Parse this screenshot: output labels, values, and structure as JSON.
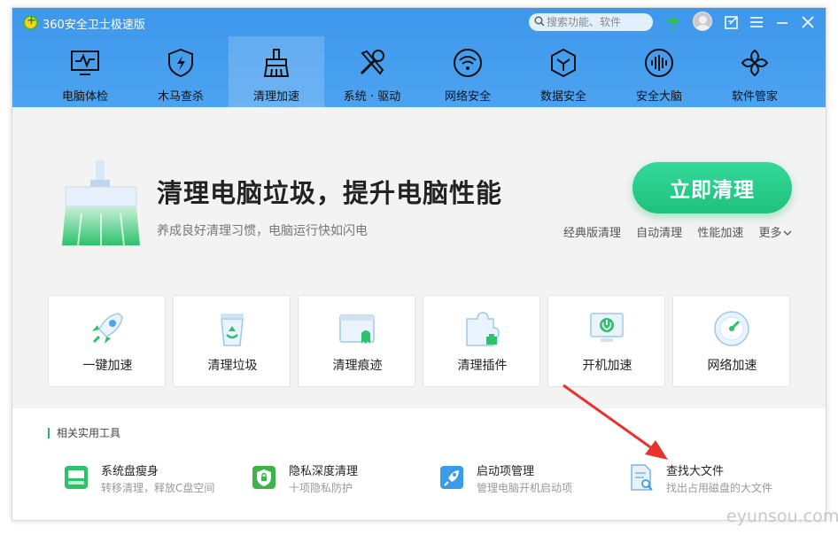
{
  "app": {
    "title": "360安全卫士极速版"
  },
  "search": {
    "placeholder": "搜索功能、软件"
  },
  "nav": {
    "items": [
      {
        "label": "电脑体检",
        "icon": "monitor-pulse-icon"
      },
      {
        "label": "木马查杀",
        "icon": "shield-bolt-icon"
      },
      {
        "label": "清理加速",
        "icon": "broom-icon",
        "active": true
      },
      {
        "label": "系统 · 驱动",
        "icon": "wrench-screwdriver-icon"
      },
      {
        "label": "网络安全",
        "icon": "wifi-icon"
      },
      {
        "label": "数据安全",
        "icon": "cube-icon"
      },
      {
        "label": "安全大脑",
        "icon": "brain-wave-icon"
      },
      {
        "label": "软件管家",
        "icon": "apps-flower-icon"
      }
    ]
  },
  "hero": {
    "title": "清理电脑垃圾，提升电脑性能",
    "subtitle": "养成良好清理习惯，电脑运行快如闪电",
    "button": "立即清理",
    "links": [
      "经典版清理",
      "自动清理",
      "性能加速",
      "更多"
    ]
  },
  "cards": [
    {
      "label": "一键加速",
      "icon": "rocket-icon"
    },
    {
      "label": "清理垃圾",
      "icon": "recycle-bin-icon"
    },
    {
      "label": "清理痕迹",
      "icon": "browser-ghost-icon"
    },
    {
      "label": "清理插件",
      "icon": "puzzle-icon"
    },
    {
      "label": "开机加速",
      "icon": "power-monitor-icon"
    },
    {
      "label": "网络加速",
      "icon": "speedometer-icon"
    }
  ],
  "related": {
    "title": "相关实用工具",
    "tools": [
      {
        "name": "系统盘瘦身",
        "desc": "转移清理，释放C盘空间",
        "icon": "disk-icon"
      },
      {
        "name": "隐私深度清理",
        "desc": "十项隐私防护",
        "icon": "privacy-lock-icon"
      },
      {
        "name": "启动项管理",
        "desc": "管理电脑开机启动项",
        "icon": "startup-rocket-icon"
      },
      {
        "name": "查找大文件",
        "desc": "找出占用磁盘的大文件",
        "icon": "file-search-icon"
      }
    ]
  },
  "watermark": "eyunsou.com",
  "colors": {
    "header": "#3f97ec",
    "accent_green": "#1ec27d",
    "arrow": "#e8332c"
  }
}
